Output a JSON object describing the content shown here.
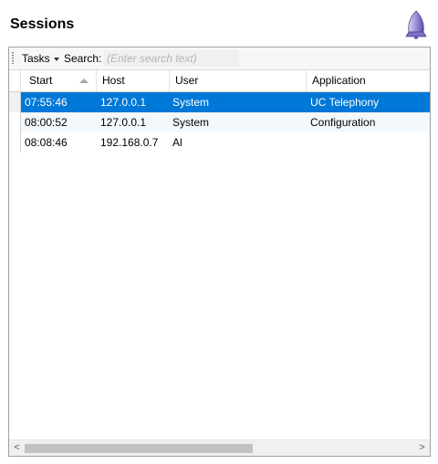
{
  "window": {
    "title": "Sessions"
  },
  "toolbar": {
    "tasks_label": "Tasks",
    "search_label": "Search:",
    "search_placeholder": "(Enter search text)",
    "search_value": ""
  },
  "grid": {
    "columns": [
      {
        "label": "Start",
        "sorted": "ascending"
      },
      {
        "label": "Host"
      },
      {
        "label": "User"
      },
      {
        "label": "Application"
      }
    ],
    "rows": [
      {
        "start": "07:55:46",
        "host": "127.0.0.1",
        "user": "System",
        "application": "UC Telephony",
        "selected": true
      },
      {
        "start": "08:00:52",
        "host": "127.0.0.1",
        "user": "System",
        "application": "Configuration"
      },
      {
        "start": "08:08:46",
        "host": "192.168.0.7",
        "user": "Al",
        "application": ""
      }
    ]
  },
  "scrollbar": {
    "left_arrow": "<",
    "right_arrow": ">"
  },
  "icons": {
    "logo": "rocket-logo-icon",
    "grip": "toolbar-grip-icon",
    "dropdown": "chevron-down-icon",
    "sort": "sort-ascending-icon"
  },
  "colors": {
    "selection": "#0078d7",
    "logo": "#9b8fd8"
  }
}
